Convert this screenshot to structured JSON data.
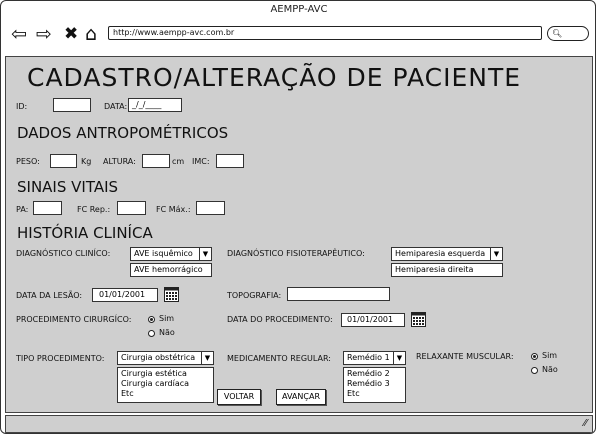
{
  "window": {
    "title": "AEMPP-AVC"
  },
  "browser": {
    "url": "http://www.aempp-avc.com.br",
    "back_icon": "back-arrow-icon",
    "forward_icon": "forward-arrow-icon",
    "stop_icon": "close-icon",
    "home_icon": "home-icon",
    "search_icon": "search-icon"
  },
  "page": {
    "title": "CADASTRO/ALTERAÇÃO DE PACIENTE",
    "id_label": "ID:",
    "date_label": "DATA:",
    "date_value": "_/_/____",
    "sections": {
      "antropometricos": "DADOS ANTROPOMÉTRICOS",
      "sinais_vitais": "SINAIS VITAIS",
      "historia_clinica": "HISTÓRIA CLINÍCA"
    },
    "antropometricos": {
      "peso_label": "PESO:",
      "peso_unit": "Kg",
      "altura_label": "ALTURA:",
      "altura_unit": "cm",
      "imc_label": "IMC:"
    },
    "sinais_vitais": {
      "pa_label": "PA:",
      "fc_rep_label": "FC Rep.:",
      "fc_max_label": "FC Máx.:"
    },
    "historia": {
      "diag_clinico_label": "DIAGNÓSTICO CLINÍCO:",
      "diag_clinico_selected": "AVE isquêmico",
      "diag_clinico_options": [
        "AVE hemorrágico"
      ],
      "diag_fisio_label": "DIAGNÓSTICO FISIOTERAPÊUTICO:",
      "diag_fisio_selected": "Hemiparesia esquerda",
      "diag_fisio_options": [
        "Hemiparesia direita"
      ],
      "data_lesao_label": "DATA DA LESÃO:",
      "data_lesao_value": "01/01/2001",
      "topografia_label": "TOPOGRAFIA:",
      "proc_cirurgico_label": "PROCEDIMENTO CIRURGÍCO:",
      "proc_cirurgico_options": [
        "Sim",
        "Não"
      ],
      "proc_cirurgico_selected": "Sim",
      "data_proc_label": "DATA DO PROCEDIMENTO:",
      "data_proc_value": "01/01/2001",
      "tipo_proc_label": "TIPO PROCEDIMENTO:",
      "tipo_proc_selected": "Cirurgia obstétrica",
      "tipo_proc_options": [
        "Cirurgia estética",
        "Cirurgia cardíaca",
        "Etc"
      ],
      "medicamento_label": "MEDICAMENTO REGULAR:",
      "medicamento_selected": "Remédio 1",
      "medicamento_options": [
        "Remédio 2",
        "Remédio 3",
        "Etc"
      ],
      "relaxante_label": "RELAXANTE MUSCULAR:",
      "relaxante_options": [
        "Sim",
        "Não"
      ],
      "relaxante_selected": "Sim"
    },
    "buttons": {
      "voltar": "VOLTAR",
      "avancar": "AVANÇAR"
    }
  }
}
